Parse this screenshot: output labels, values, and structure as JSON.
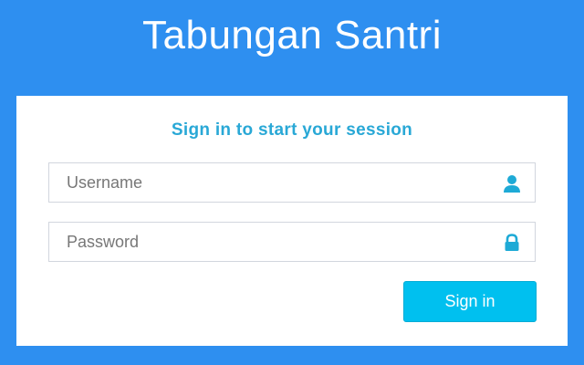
{
  "app": {
    "title": "Tabungan Santri"
  },
  "login": {
    "message": "Sign in to start your session",
    "username": {
      "placeholder": "Username",
      "value": "",
      "icon": "user-icon"
    },
    "password": {
      "placeholder": "Password",
      "value": "",
      "icon": "lock-icon"
    },
    "submit_label": "Sign in"
  },
  "colors": {
    "page_background": "#2e8ff0",
    "box_background": "#ffffff",
    "accent": "#29a8d6",
    "button": "#00c0ef",
    "icon": "#1eaad6"
  }
}
